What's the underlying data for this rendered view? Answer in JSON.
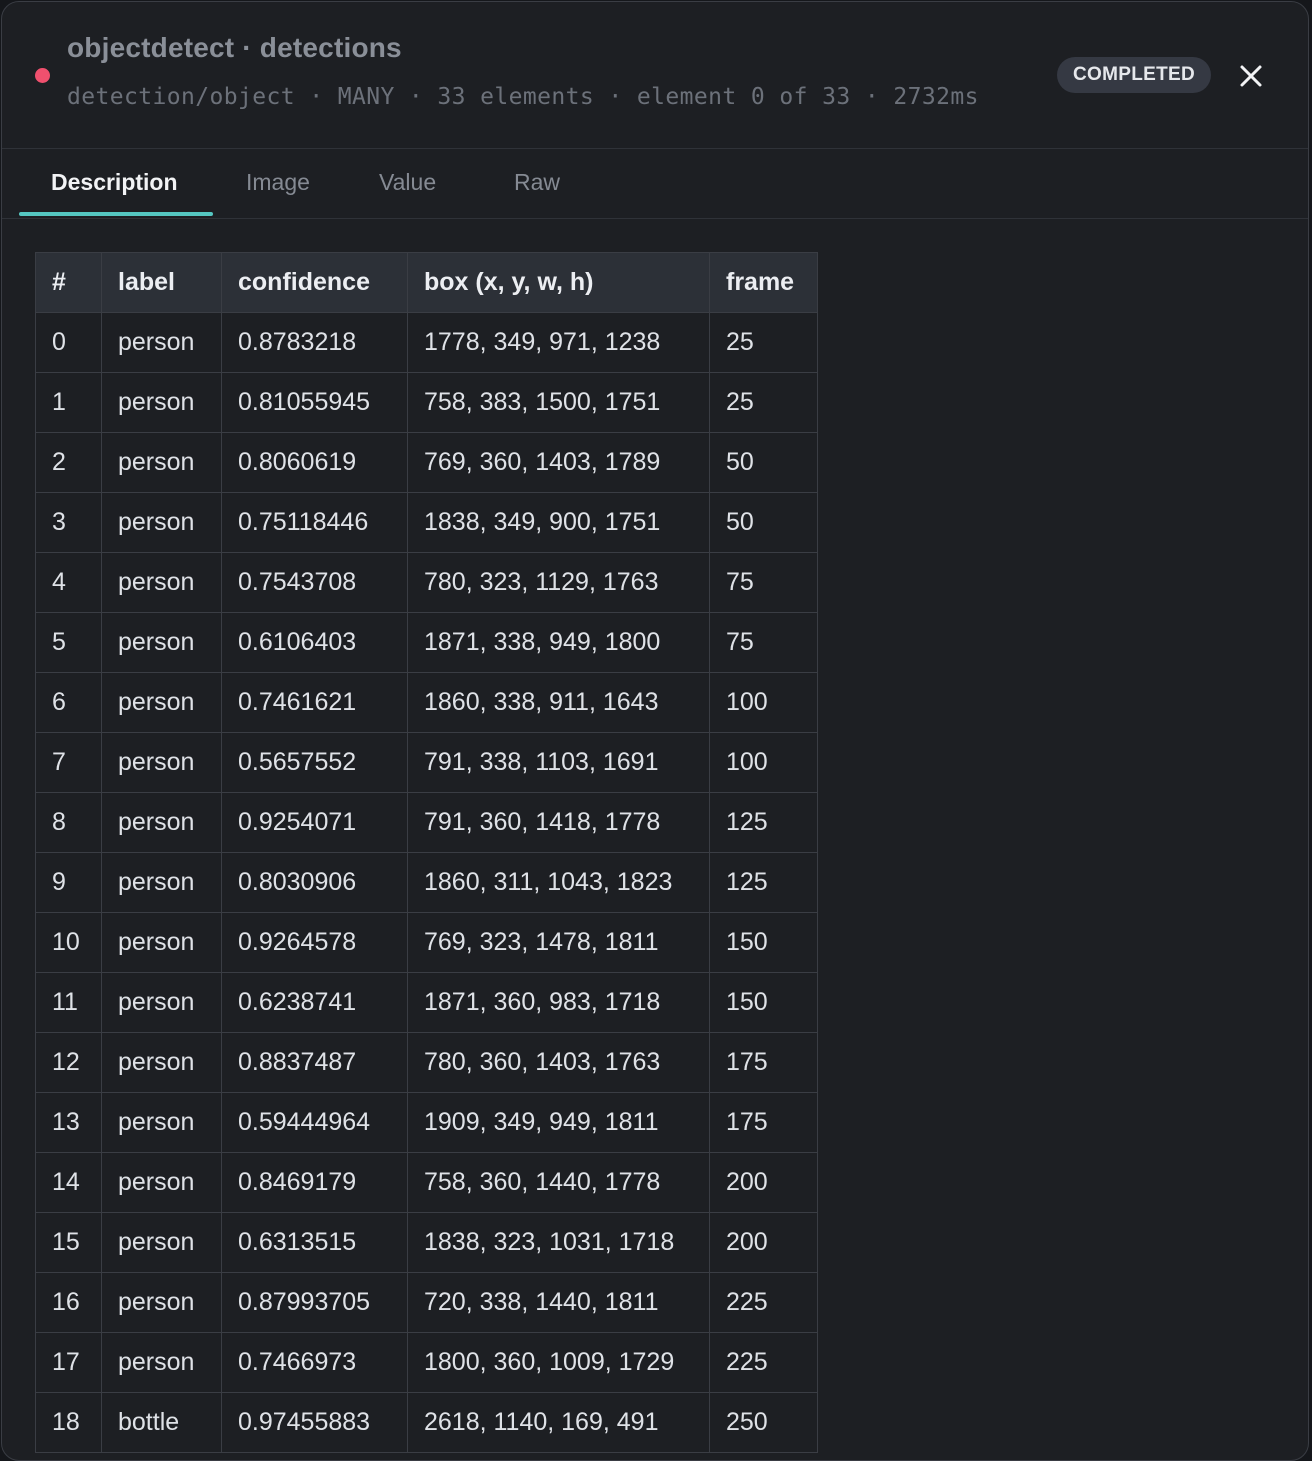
{
  "header": {
    "title": "objectdetect · detections",
    "subtitle": "detection/object · MANY · 33 elements · element 0 of 33 · 2732ms",
    "status": "COMPLETED",
    "status_dot_color": "#f0506e"
  },
  "tabs": [
    {
      "label": "Description",
      "active": true
    },
    {
      "label": "Image",
      "active": false
    },
    {
      "label": "Value",
      "active": false
    },
    {
      "label": "Raw",
      "active": false
    }
  ],
  "table": {
    "columns": [
      "#",
      "label",
      "confidence",
      "box (x, y, w, h)",
      "frame"
    ],
    "rows": [
      [
        "0",
        "person",
        "0.8783218",
        "1778, 349, 971, 1238",
        "25"
      ],
      [
        "1",
        "person",
        "0.81055945",
        "758, 383, 1500, 1751",
        "25"
      ],
      [
        "2",
        "person",
        "0.8060619",
        "769, 360, 1403, 1789",
        "50"
      ],
      [
        "3",
        "person",
        "0.75118446",
        "1838, 349, 900, 1751",
        "50"
      ],
      [
        "4",
        "person",
        "0.7543708",
        "780, 323, 1129, 1763",
        "75"
      ],
      [
        "5",
        "person",
        "0.6106403",
        "1871, 338, 949, 1800",
        "75"
      ],
      [
        "6",
        "person",
        "0.7461621",
        "1860, 338, 911, 1643",
        "100"
      ],
      [
        "7",
        "person",
        "0.5657552",
        "791, 338, 1103, 1691",
        "100"
      ],
      [
        "8",
        "person",
        "0.9254071",
        "791, 360, 1418, 1778",
        "125"
      ],
      [
        "9",
        "person",
        "0.8030906",
        "1860, 311, 1043, 1823",
        "125"
      ],
      [
        "10",
        "person",
        "0.9264578",
        "769, 323, 1478, 1811",
        "150"
      ],
      [
        "11",
        "person",
        "0.6238741",
        "1871, 360, 983, 1718",
        "150"
      ],
      [
        "12",
        "person",
        "0.8837487",
        "780, 360, 1403, 1763",
        "175"
      ],
      [
        "13",
        "person",
        "0.59444964",
        "1909, 349, 949, 1811",
        "175"
      ],
      [
        "14",
        "person",
        "0.8469179",
        "758, 360, 1440, 1778",
        "200"
      ],
      [
        "15",
        "person",
        "0.6313515",
        "1838, 323, 1031, 1718",
        "200"
      ],
      [
        "16",
        "person",
        "0.87993705",
        "720, 338, 1440, 1811",
        "225"
      ],
      [
        "17",
        "person",
        "0.7466973",
        "1800, 360, 1009, 1729",
        "225"
      ],
      [
        "18",
        "bottle",
        "0.97455883",
        "2618, 1140, 169, 491",
        "250"
      ]
    ]
  },
  "accent_color": "#55c7c2"
}
